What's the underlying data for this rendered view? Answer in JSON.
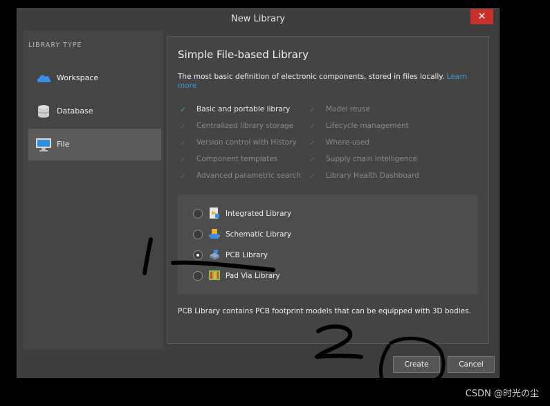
{
  "window": {
    "title": "New Library",
    "close_glyph": "✕"
  },
  "sidebar": {
    "heading": "LIBRARY TYPE",
    "items": [
      {
        "label": "Workspace",
        "icon": "cloud-icon",
        "active": false
      },
      {
        "label": "Database",
        "icon": "database-icon",
        "active": false
      },
      {
        "label": "File",
        "icon": "monitor-icon",
        "active": true
      }
    ]
  },
  "panel": {
    "title": "Simple File-based Library",
    "description": "The most basic definition of electronic components, stored in files locally.",
    "learn_more": "Learn more",
    "features_left": [
      {
        "label": "Basic and portable library",
        "enabled": true
      },
      {
        "label": "Centralized library storage",
        "enabled": false
      },
      {
        "label": "Version control with History",
        "enabled": false
      },
      {
        "label": "Component templates",
        "enabled": false
      },
      {
        "label": "Advanced parametric search",
        "enabled": false
      }
    ],
    "features_right": [
      {
        "label": "Model reuse",
        "enabled": false
      },
      {
        "label": "Lifecycle management",
        "enabled": false
      },
      {
        "label": "Where-used",
        "enabled": false
      },
      {
        "label": "Supply chain intelligence",
        "enabled": false
      },
      {
        "label": "Library Health Dashboard",
        "enabled": false
      }
    ],
    "options": [
      {
        "label": "Integrated Library",
        "icon": "integrated-library-icon",
        "selected": false
      },
      {
        "label": "Schematic Library",
        "icon": "schematic-library-icon",
        "selected": false
      },
      {
        "label": "PCB Library",
        "icon": "pcb-library-icon",
        "selected": true
      },
      {
        "label": "Pad Via Library",
        "icon": "pad-via-library-icon",
        "selected": false
      }
    ],
    "footnote": "PCB Library contains PCB footprint models that can be equipped with 3D bodies."
  },
  "buttons": {
    "create": "Create",
    "cancel": "Cancel"
  },
  "annotations": {
    "mark1": "1",
    "mark2": "2"
  },
  "watermark": "CSDN @时光の尘",
  "colors": {
    "accent_link": "#3b9ad9",
    "close_red": "#c9302c",
    "check_green": "#4caf50"
  }
}
